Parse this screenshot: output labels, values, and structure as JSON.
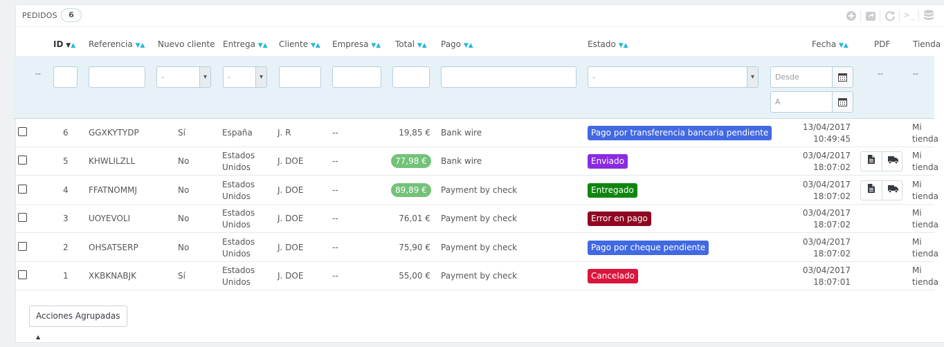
{
  "panel": {
    "title": "PEDIDOS",
    "count": "6"
  },
  "toolbar": {
    "icons": [
      "add-icon",
      "export-icon",
      "refresh-icon",
      "terminal-icon",
      "database-icon"
    ]
  },
  "columns": {
    "id": "ID",
    "referencia": "Referencia",
    "nuevo_cliente": "Nuevo cliente",
    "entrega": "Entrega",
    "cliente": "Cliente",
    "empresa": "Empresa",
    "total": "Total",
    "pago": "Pago",
    "estado": "Estado",
    "fecha": "Fecha",
    "pdf": "PDF",
    "tienda": "Tienda"
  },
  "filters": {
    "first_dash": "--",
    "nuevo_cliente_value": "-",
    "entrega_value": "-",
    "estado_value": "-",
    "fecha_desde_placeholder": "Desde",
    "fecha_a_placeholder": "A",
    "pdf_dash": "--",
    "tienda_dash": "--"
  },
  "orders": [
    {
      "id": "6",
      "ref": "GGXKYTYDP",
      "new_client": "Sí",
      "delivery": [
        "España",
        ""
      ],
      "client": "J. R",
      "company": "--",
      "total": "19,85 €",
      "total_highlight": false,
      "payment": "Bank wire",
      "state": "Pago por transferencia bancaria pendiente",
      "state_color": "#4169e1",
      "date": "13/04/2017",
      "time": "10:49:45",
      "pdf": false,
      "shop": [
        "Mi",
        "tienda"
      ]
    },
    {
      "id": "5",
      "ref": "KHWLILZLL",
      "new_client": "No",
      "delivery": [
        "Estados",
        "Unidos"
      ],
      "client": "J. DOE",
      "company": "--",
      "total": "77,98 €",
      "total_highlight": true,
      "payment": "Bank wire",
      "state": "Enviado",
      "state_color": "#8a2be2",
      "date": "03/04/2017",
      "time": "18:07:02",
      "pdf": true,
      "shop": [
        "Mi",
        "tienda"
      ]
    },
    {
      "id": "4",
      "ref": "FFATNOMMJ",
      "new_client": "No",
      "delivery": [
        "Estados",
        "Unidos"
      ],
      "client": "J. DOE",
      "company": "--",
      "total": "89,89 €",
      "total_highlight": true,
      "payment": "Payment by check",
      "state": "Entregado",
      "state_color": "#108510",
      "date": "03/04/2017",
      "time": "18:07:02",
      "pdf": true,
      "shop": [
        "Mi",
        "tienda"
      ]
    },
    {
      "id": "3",
      "ref": "UOYEVOLI",
      "new_client": "No",
      "delivery": [
        "Estados",
        "Unidos"
      ],
      "client": "J. DOE",
      "company": "--",
      "total": "76,01 €",
      "total_highlight": false,
      "payment": "Payment by check",
      "state": "Error en pago",
      "state_color": "#8f0621",
      "date": "03/04/2017",
      "time": "18:07:02",
      "pdf": false,
      "shop": [
        "Mi",
        "tienda"
      ]
    },
    {
      "id": "2",
      "ref": "OHSATSERP",
      "new_client": "No",
      "delivery": [
        "Estados",
        "Unidos"
      ],
      "client": "J. DOE",
      "company": "--",
      "total": "75,90 €",
      "total_highlight": false,
      "payment": "Payment by check",
      "state": "Pago por cheque pendiente",
      "state_color": "#4169e1",
      "date": "03/04/2017",
      "time": "18:07:02",
      "pdf": false,
      "shop": [
        "Mi",
        "tienda"
      ]
    },
    {
      "id": "1",
      "ref": "XKBKNABJK",
      "new_client": "Sí",
      "delivery": [
        "Estados",
        "Unidos"
      ],
      "client": "J. DOE",
      "company": "--",
      "total": "55,00 €",
      "total_highlight": false,
      "payment": "Payment by check",
      "state": "Cancelado",
      "state_color": "#dc143c",
      "date": "03/04/2017",
      "time": "18:07:01",
      "pdf": false,
      "shop": [
        "Mi",
        "tienda"
      ]
    }
  ],
  "bulk_actions": {
    "label": "Acciones Agrupadas",
    "caret": "▲"
  }
}
